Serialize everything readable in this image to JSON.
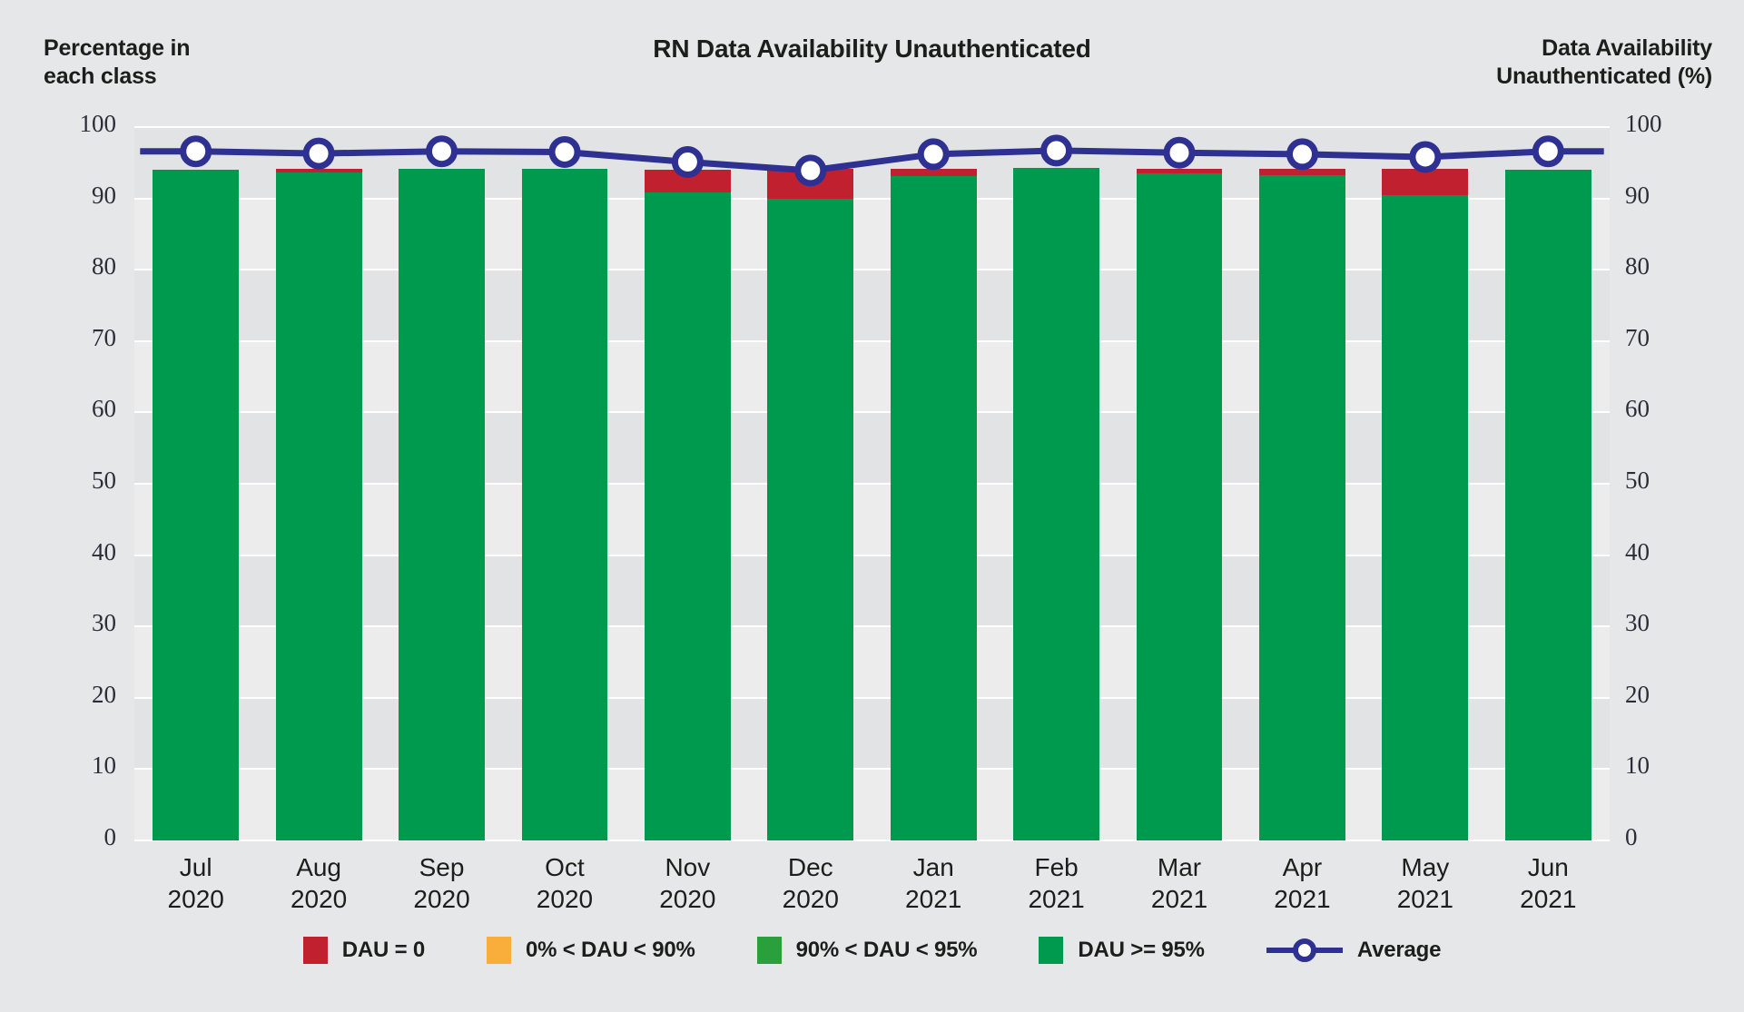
{
  "chart_title": "RN Data Availability Unauthenticated",
  "left_axis_caption_line1": "Percentage in",
  "left_axis_caption_line2": "each class",
  "right_axis_caption_line1": "Data Availability",
  "right_axis_caption_line2": "Unauthenticated (%)",
  "colors": {
    "background": "#e6e7e8",
    "band_light": "#ececec",
    "band_dark": "#e2e3e5",
    "gridline": "#ffffff",
    "dau_zero": "#c1212f",
    "dau_lt90": "#f9ae3b",
    "dau_90_95": "#2aa03c",
    "dau_ge95": "#009a4e",
    "average_line": "#2e3192",
    "marker_fill": "#ffffff",
    "text": "#1d1d1b"
  },
  "chart_data": {
    "type": "bar",
    "title": "RN Data Availability Unauthenticated",
    "xlabel": "",
    "ylabel": "Percentage in each class",
    "y2label": "Data Availability Unauthenticated (%)",
    "ylim": [
      0,
      100
    ],
    "y2lim": [
      0,
      100
    ],
    "ytick_labels": [
      "100",
      "90",
      "80",
      "70",
      "60",
      "50",
      "40",
      "30",
      "20",
      "10",
      "0"
    ],
    "ytick_values": [
      100,
      90,
      80,
      70,
      60,
      50,
      40,
      30,
      20,
      10,
      0
    ],
    "y2tick_labels": [
      "100",
      "90",
      "80",
      "70",
      "60",
      "50",
      "40",
      "30",
      "20",
      "10",
      "0"
    ],
    "grid": true,
    "legend_position": "bottom",
    "stacked": true,
    "categories": [
      "Jul 2020",
      "Aug 2020",
      "Sep 2020",
      "Oct 2020",
      "Nov 2020",
      "Dec 2020",
      "Jan 2021",
      "Feb 2021",
      "Mar 2021",
      "Apr 2021",
      "May 2021",
      "Jun 2021"
    ],
    "category_months": [
      "Jul",
      "Aug",
      "Sep",
      "Oct",
      "Nov",
      "Dec",
      "Jan",
      "Feb",
      "Mar",
      "Apr",
      "May",
      "Jun"
    ],
    "category_years": [
      "2020",
      "2020",
      "2020",
      "2020",
      "2020",
      "2020",
      "2021",
      "2021",
      "2021",
      "2021",
      "2021",
      "2021"
    ],
    "series": [
      {
        "name": "DAU >= 95%",
        "color": "#009a4e",
        "values": [
          94.0,
          93.6,
          94.1,
          94.1,
          90.9,
          90.0,
          93.1,
          94.3,
          93.5,
          93.2,
          90.4,
          94.0
        ]
      },
      {
        "name": "90% < DAU < 95%",
        "color": "#2aa03c",
        "values": [
          0.0,
          0.0,
          0.0,
          0.0,
          0.0,
          0.0,
          0.0,
          0.0,
          0.0,
          0.0,
          0.0,
          0.0
        ]
      },
      {
        "name": "0% < DAU < 90%",
        "color": "#f9ae3b",
        "values": [
          0.0,
          0.0,
          0.0,
          0.0,
          0.0,
          0.0,
          0.0,
          0.0,
          0.0,
          0.0,
          0.0,
          0.0
        ]
      },
      {
        "name": "DAU = 0",
        "color": "#c1212f",
        "values": [
          0.0,
          0.5,
          0.0,
          0.0,
          3.1,
          4.1,
          1.0,
          0.0,
          0.7,
          1.0,
          3.7,
          0.0
        ]
      }
    ],
    "average_series": {
      "name": "Average",
      "color": "#2e3192",
      "marker": "circle-open",
      "values": [
        96.6,
        96.3,
        96.6,
        96.5,
        95.1,
        93.9,
        96.2,
        96.7,
        96.4,
        96.2,
        95.8,
        96.6
      ]
    }
  },
  "legend": [
    {
      "label": "DAU = 0",
      "color": "#c1212f",
      "kind": "swatch"
    },
    {
      "label": "0% < DAU < 90%",
      "color": "#f9ae3b",
      "kind": "swatch"
    },
    {
      "label": "90% < DAU < 95%",
      "color": "#2aa03c",
      "kind": "swatch"
    },
    {
      "label": "DAU >= 95%",
      "color": "#009a4e",
      "kind": "swatch"
    },
    {
      "label": "Average",
      "color": "#2e3192",
      "kind": "line-marker"
    }
  ]
}
